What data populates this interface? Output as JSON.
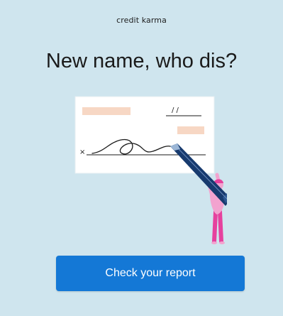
{
  "brand": {
    "logo_text": "credit karma"
  },
  "headline": "New name, who dis?",
  "cta": {
    "label": "Check your report"
  },
  "illustration": {
    "date_marks": "/ /",
    "x_mark": "×"
  },
  "colors": {
    "background": "#cfe5ee",
    "button": "#1478d6",
    "check_fill": "#ffffff",
    "highlight_peach": "#f7d7c4",
    "pen_navy": "#173a6e",
    "figure_pink": "#f2a3cf",
    "figure_magenta": "#e6419e"
  }
}
